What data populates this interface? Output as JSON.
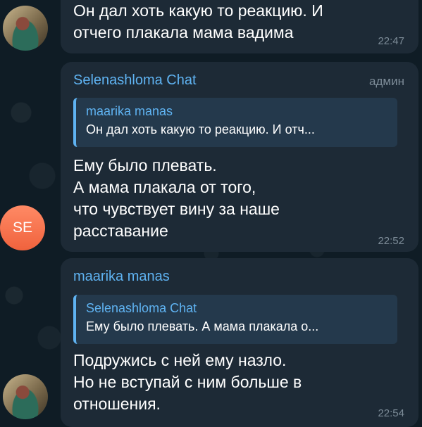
{
  "avatars": {
    "selena_initials": "SE"
  },
  "messages": [
    {
      "text_lines": [
        "Он дал хоть какую то реакцию. И",
        "отчего плакала мама вадима"
      ],
      "time": "22:47"
    },
    {
      "sender": "Selenashloma Chat",
      "role": "админ",
      "reply": {
        "name": "maarika manas",
        "text": "Он дал хоть какую то реакцию. И отч..."
      },
      "text_lines": [
        "Ему было плевать.",
        "А мама плакала от того,",
        "что чувствует вину за наше",
        "расставание"
      ],
      "time": "22:52"
    },
    {
      "sender": "maarika manas",
      "reply": {
        "name": "Selenashloma Chat",
        "text": "Ему было плевать. А мама плакала о..."
      },
      "text_lines": [
        "Подружись с ней ему назло.",
        "Но не вступай с ним больше в",
        "отношения."
      ],
      "time": "22:54"
    }
  ],
  "colors": {
    "background": "#0f1c25",
    "bubble": "#1d2a36",
    "accent": "#5fb3f2",
    "reply_bg": "#24394c",
    "avatar_se": "#f47a50"
  }
}
